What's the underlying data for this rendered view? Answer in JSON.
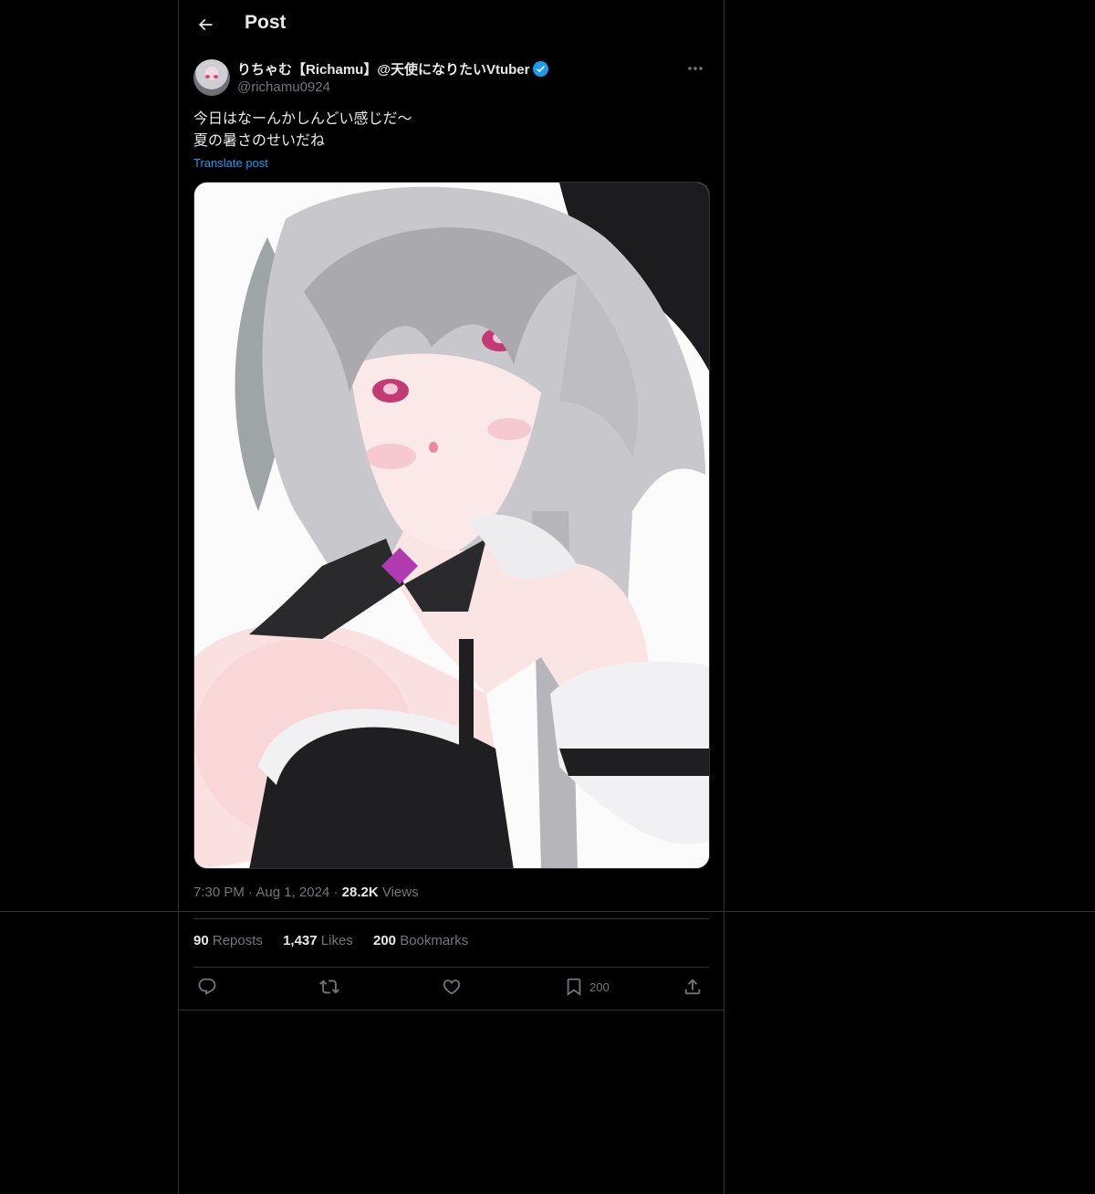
{
  "header": {
    "title": "Post"
  },
  "author": {
    "display_name": "りちゃむ【Richamu】@天使になりたいVtuber",
    "handle": "@richamu0924",
    "verified": true
  },
  "post": {
    "lines": [
      "今日はなーんかしんどい感じだ〜",
      "夏の暑さのせいだね"
    ],
    "translate_label": "Translate post",
    "time": "7:30 PM",
    "date": "Aug 1, 2024",
    "views_count": "28.2K",
    "views_label": "Views"
  },
  "stats": {
    "reposts_count": "90",
    "reposts_label": "Reposts",
    "likes_count": "1,437",
    "likes_label": "Likes",
    "bookmarks_count": "200",
    "bookmarks_label": "Bookmarks"
  },
  "actions": {
    "bookmark_count": "200"
  },
  "colors": {
    "accent": "#1d9bf0",
    "muted": "#71767b",
    "divider": "#2f3336"
  }
}
